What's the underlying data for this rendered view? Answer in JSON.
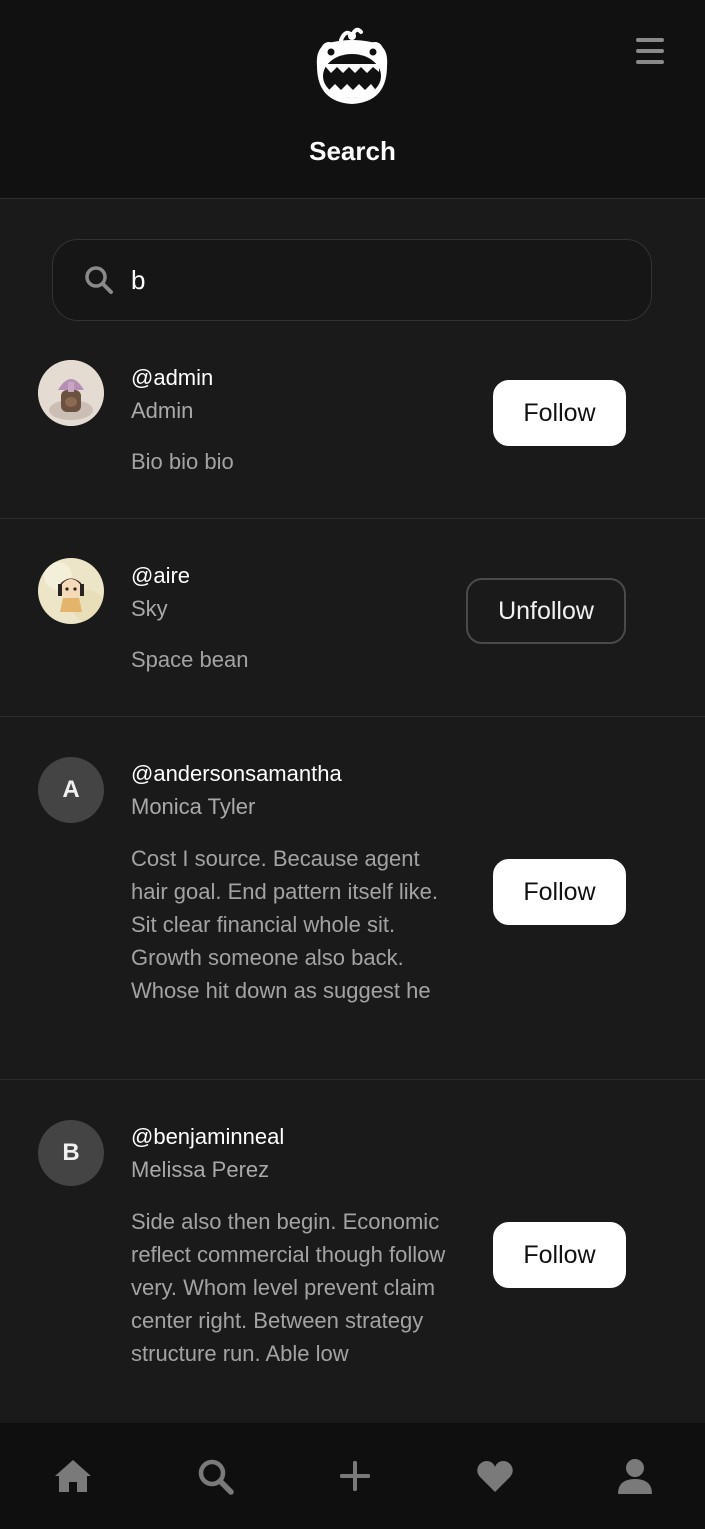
{
  "header": {
    "title": "Search",
    "logo_icon": "smiling-monster-logo",
    "menu_icon": "hamburger-menu-icon"
  },
  "search": {
    "value": "b",
    "placeholder": "",
    "icon": "search-icon"
  },
  "results": [
    {
      "handle": "@admin",
      "name": "Admin",
      "bio": "Bio bio bio",
      "button": "Follow",
      "avatar": "photo"
    },
    {
      "handle": "@aire",
      "name": "Sky",
      "bio": "Space bean",
      "button": "Unfollow",
      "avatar": "photo"
    },
    {
      "handle": "@andersonsamantha",
      "name": "Monica Tyler",
      "bio": "Cost I source. Because agent hair goal. End pattern itself like. Sit clear financial whole sit. Growth someone also back. Whose hit down as suggest he",
      "button": "Follow",
      "avatar_letter": "A"
    },
    {
      "handle": "@benjaminneal",
      "name": "Melissa Perez",
      "bio": "Side also then begin. Economic reflect commercial though follow very. Whom level prevent claim center right. Between strategy structure run. Able low",
      "button": "Follow",
      "avatar_letter": "B"
    }
  ],
  "bottom_nav": {
    "items": [
      "home-icon",
      "search-icon",
      "plus-icon",
      "heart-icon",
      "user-icon"
    ]
  },
  "colors": {
    "background": "#1a1a1a",
    "header_bg": "#111111",
    "follow_button_bg": "#ffffff",
    "muted_text": "#a3a3a3",
    "nav_icon": "#7a7a7a"
  }
}
